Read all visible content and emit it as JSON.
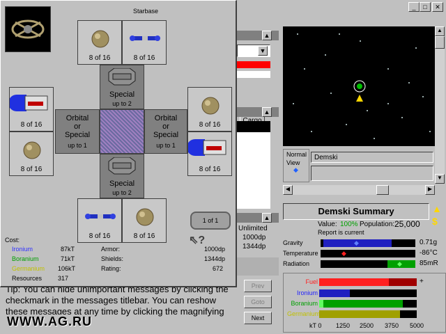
{
  "dialog": {
    "title": "Starbase",
    "slots": {
      "top_left": "8 of 16",
      "top_right": "8 of 16",
      "left_top": "8 of 16",
      "left_bottom": "8 of 16",
      "right_top": "8 of 16",
      "right_bottom": "8 of 16",
      "bottom_left": "8 of 16",
      "bottom_right": "8 of 16"
    },
    "special_top": {
      "line1": "Special",
      "line2": "up to 2"
    },
    "special_bottom": {
      "line1": "Special",
      "line2": "up to 2"
    },
    "orbital_left": {
      "line1": "Orbital",
      "line2": "or",
      "line3": "Special",
      "line4": "up to 1"
    },
    "orbital_right": {
      "line1": "Orbital",
      "line2": "or",
      "line3": "Special",
      "line4": "up to 1"
    },
    "page_indicator": "1 of 1",
    "cost_label": "Cost:",
    "minerals": [
      {
        "name": "Ironium",
        "value": "87kT",
        "color": "#3030ff"
      },
      {
        "name": "Boranium",
        "value": "71kT",
        "color": "#00a000"
      },
      {
        "name": "Germanium",
        "value": "106kT",
        "color": "#c0c000"
      },
      {
        "name": "Resources",
        "value": "317",
        "color": "#000000"
      }
    ],
    "stats": [
      {
        "label": "Armor:",
        "value": "1000dp"
      },
      {
        "label": "Shields:",
        "value": "1344dp"
      },
      {
        "label": "Rating:",
        "value": "672"
      }
    ]
  },
  "left_partial": {
    "value1": "Unlimited",
    "value2": "1000dp",
    "value3": "1344dp",
    "cargo_button": "Cargo"
  },
  "messages": {
    "tip": "Tip: You can hide unimportant messages by clicking the checkmark in the messages titlebar. You can reshow these messages at any time by clicking the magnifying glass in the titlebar.",
    "prev_button": "Prev",
    "goto_button": "Goto",
    "next_button": "Next",
    "watermark": "WWW.AG.RU"
  },
  "scanner": {
    "view_label_1": "Normal",
    "view_label_2": "View",
    "planet_field": "Demski"
  },
  "summary": {
    "title": "Demski Summary",
    "value_label": "Value:",
    "value": "100%",
    "population_label": "Population:",
    "population": "25,000",
    "report": "Report is current",
    "habitability": [
      {
        "label": "Gravity",
        "value": "0.71g",
        "color": "#2020c0"
      },
      {
        "label": "Temperature",
        "value": "-86°C",
        "color": "#c00000"
      },
      {
        "label": "Radiation",
        "value": "85mR",
        "color": "#00a000"
      }
    ],
    "minerals": [
      {
        "label": "Fuel",
        "color": "#ff2020"
      },
      {
        "label": "Ironium",
        "color": "#2020ff"
      },
      {
        "label": "Boranium",
        "color": "#00a000"
      },
      {
        "label": "Germanium",
        "color": "#c0c000"
      }
    ],
    "axis": [
      "kT 0",
      "1250",
      "2500",
      "3750",
      "5000"
    ],
    "plus": "+"
  },
  "colors": {
    "space": "#000000",
    "window_bg": "#c0c0c0",
    "accent": "#000080"
  }
}
